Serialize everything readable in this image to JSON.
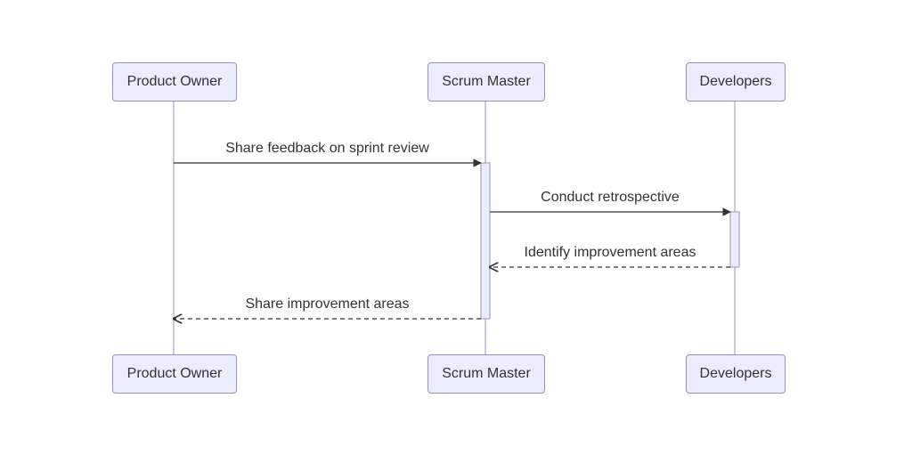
{
  "participants": {
    "product_owner": "Product Owner",
    "scrum_master": "Scrum Master",
    "developers": "Developers"
  },
  "messages": {
    "m1": "Share feedback on sprint review",
    "m2": "Conduct retrospective",
    "m3": "Identify improvement areas",
    "m4": "Share improvement areas"
  },
  "chart_data": {
    "type": "sequence_diagram",
    "participants": [
      "Product Owner",
      "Scrum Master",
      "Developers"
    ],
    "messages": [
      {
        "from": "Product Owner",
        "to": "Scrum Master",
        "label": "Share feedback on sprint review",
        "style": "solid"
      },
      {
        "from": "Scrum Master",
        "to": "Developers",
        "label": "Conduct retrospective",
        "style": "solid"
      },
      {
        "from": "Developers",
        "to": "Scrum Master",
        "label": "Identify improvement areas",
        "style": "dashed"
      },
      {
        "from": "Scrum Master",
        "to": "Product Owner",
        "label": "Share improvement areas",
        "style": "dashed"
      }
    ]
  }
}
